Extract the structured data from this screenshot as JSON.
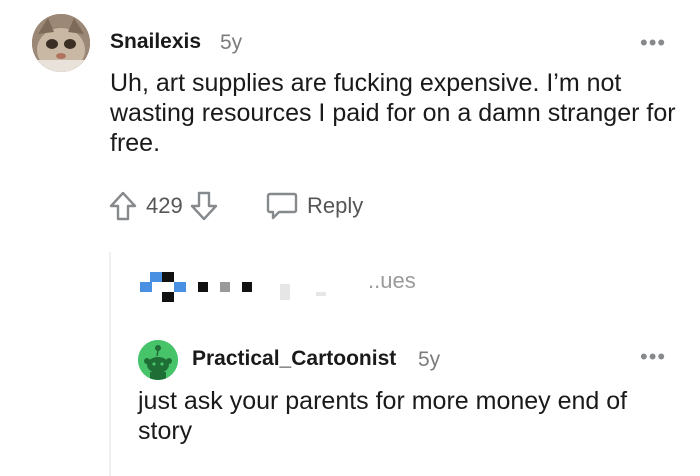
{
  "comment": {
    "username": "Snailexis",
    "age": "5y",
    "body": "Uh, art supplies are fucking expensive. I’m not wasting resources I paid for on a damn stranger for free.",
    "votes": "429",
    "reply_label": "Reply",
    "more_label": "•••"
  },
  "hidden_row": {
    "partial_text": "..ues"
  },
  "reply": {
    "username": "Practical_Cartoonist",
    "age": "5y",
    "body": "just ask your parents for more money end of story",
    "more_label": "•••"
  },
  "colors": {
    "upvote_stroke": "#878a8c",
    "avatar2_bg": "#47c46a",
    "pixel_blue": "#4a90e2"
  }
}
